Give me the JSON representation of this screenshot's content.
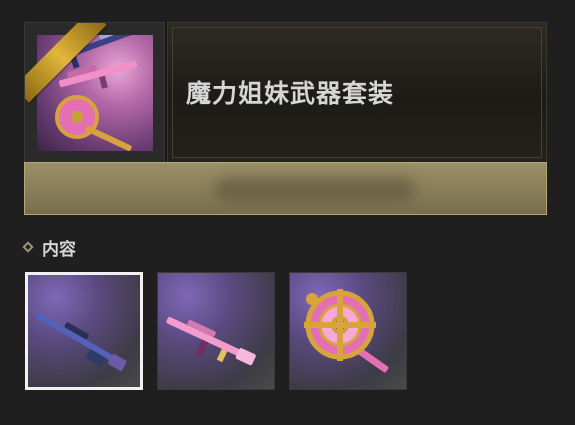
{
  "bundle": {
    "title": "魔力姐妹武器套装"
  },
  "contents": {
    "section_label": "内容",
    "items": [
      {
        "name": "sniper-rifle-skin",
        "selected": true
      },
      {
        "name": "assault-rifle-skin",
        "selected": false
      },
      {
        "name": "shield-emblem-skin",
        "selected": false
      }
    ]
  },
  "colors": {
    "background": "#1f1f1f",
    "gold_accent": "#e2b63a",
    "selection_border": "#f1f1f1",
    "item_purple": "#7f68b8",
    "pink": "#e46fb5"
  }
}
